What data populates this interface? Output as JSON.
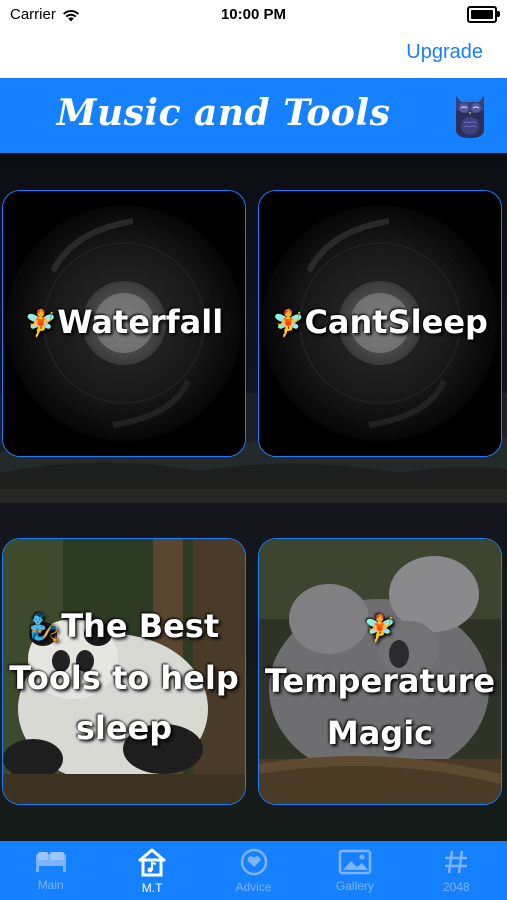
{
  "status": {
    "carrier": "Carrier",
    "time": "10:00 PM"
  },
  "nav": {
    "upgrade_label": "Upgrade"
  },
  "header": {
    "title": "Music and Tools"
  },
  "cards": [
    {
      "label": "Waterfall",
      "emoji": "🧚"
    },
    {
      "label": "CantSleep",
      "emoji": "🧚"
    },
    {
      "label_lines": [
        "The Best",
        "Tools to help",
        "sleep"
      ],
      "emoji": "🧞"
    },
    {
      "label_lines": [
        "Temperature",
        "Magic"
      ],
      "emoji": "🧚"
    }
  ],
  "tabs": [
    {
      "label": "Main",
      "icon": "bed-icon"
    },
    {
      "label": "M.T",
      "icon": "house-music-icon",
      "active": true
    },
    {
      "label": "Advice",
      "icon": "heart-icon"
    },
    {
      "label": "Gallery",
      "icon": "photo-icon"
    },
    {
      "label": "2048",
      "icon": "hash-icon"
    }
  ],
  "colors": {
    "accent": "#1681ff",
    "link": "#1a7ef7",
    "tab_inactive": "#7db3ff"
  }
}
